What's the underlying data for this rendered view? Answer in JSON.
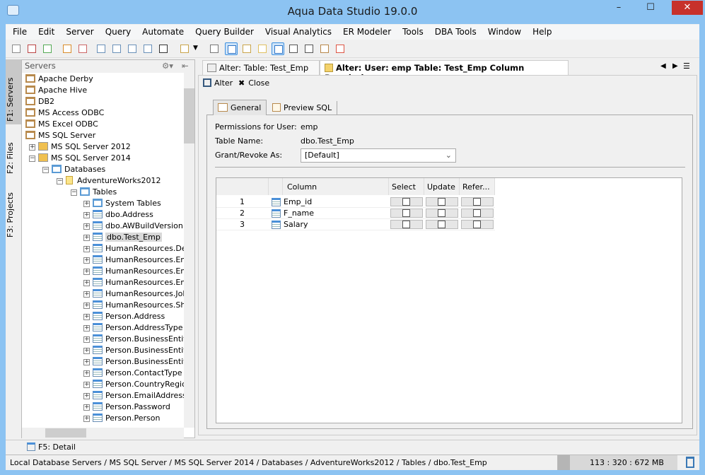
{
  "window": {
    "title": "Aqua Data Studio 19.0.0",
    "controls": [
      "–",
      "☐",
      "✕"
    ]
  },
  "menu": [
    "File",
    "Edit",
    "Server",
    "Query",
    "Automate",
    "Query Builder",
    "Visual Analytics",
    "ER Modeler",
    "Tools",
    "DBA Tools",
    "Window",
    "Help"
  ],
  "side_tabs": [
    "F1: Servers",
    "F2: Files",
    "F3: Projects"
  ],
  "servers": {
    "title": "Servers",
    "tree": [
      {
        "label": "Apache Derby",
        "level": 0,
        "icon": "folder-icon"
      },
      {
        "label": "Apache Hive",
        "level": 0,
        "icon": "folder-icon"
      },
      {
        "label": "DB2",
        "level": 0,
        "icon": "folder-icon"
      },
      {
        "label": "MS Access ODBC",
        "level": 0,
        "icon": "folder-icon"
      },
      {
        "label": "MS Excel ODBC",
        "level": 0,
        "icon": "folder-icon"
      },
      {
        "label": "MS SQL Server",
        "level": 0,
        "icon": "folder-icon"
      },
      {
        "label": "MS SQL Server 2012",
        "level": 1,
        "icon": "server-icon",
        "exp": "+"
      },
      {
        "label": "MS SQL Server 2014",
        "level": 1,
        "icon": "server-connected-icon",
        "exp": "−"
      },
      {
        "label": "Databases",
        "level": 2,
        "icon": "databases-icon",
        "exp": "−"
      },
      {
        "label": "AdventureWorks2012",
        "level": 3,
        "icon": "database-icon",
        "exp": "−"
      },
      {
        "label": "Tables",
        "level": 4,
        "icon": "tables-folder-icon",
        "exp": "−"
      },
      {
        "label": "System Tables",
        "level": 5,
        "icon": "tables-folder-icon",
        "exp": "+"
      },
      {
        "label": "dbo.Address",
        "level": 5,
        "icon": "table-icon",
        "exp": "+"
      },
      {
        "label": "dbo.AWBuildVersion",
        "level": 5,
        "icon": "table-icon",
        "exp": "+"
      },
      {
        "label": "dbo.Test_Emp",
        "level": 5,
        "icon": "table-icon",
        "exp": "+",
        "selected": true
      },
      {
        "label": "HumanResources.Depa",
        "level": 5,
        "icon": "table-icon",
        "exp": "+"
      },
      {
        "label": "HumanResources.Emplo",
        "level": 5,
        "icon": "table-icon",
        "exp": "+"
      },
      {
        "label": "HumanResources.Emplo",
        "level": 5,
        "icon": "table-icon",
        "exp": "+"
      },
      {
        "label": "HumanResources.Emplo",
        "level": 5,
        "icon": "table-icon",
        "exp": "+"
      },
      {
        "label": "HumanResources.JobC",
        "level": 5,
        "icon": "table-icon",
        "exp": "+"
      },
      {
        "label": "HumanResources.Shift",
        "level": 5,
        "icon": "table-icon",
        "exp": "+"
      },
      {
        "label": "Person.Address",
        "level": 5,
        "icon": "table-icon",
        "exp": "+"
      },
      {
        "label": "Person.AddressType",
        "level": 5,
        "icon": "table-icon",
        "exp": "+"
      },
      {
        "label": "Person.BusinessEntity",
        "level": 5,
        "icon": "table-icon",
        "exp": "+"
      },
      {
        "label": "Person.BusinessEntityA",
        "level": 5,
        "icon": "table-icon",
        "exp": "+"
      },
      {
        "label": "Person.BusinessEntityC",
        "level": 5,
        "icon": "table-icon",
        "exp": "+"
      },
      {
        "label": "Person.ContactType",
        "level": 5,
        "icon": "table-icon",
        "exp": "+"
      },
      {
        "label": "Person.CountryRegion",
        "level": 5,
        "icon": "table-icon",
        "exp": "+"
      },
      {
        "label": "Person.EmailAddress",
        "level": 5,
        "icon": "table-icon",
        "exp": "+"
      },
      {
        "label": "Person.Password",
        "level": 5,
        "icon": "table-icon",
        "exp": "+"
      },
      {
        "label": "Person.Person",
        "level": 5,
        "icon": "table-icon",
        "exp": "+"
      }
    ]
  },
  "editor_tabs": [
    {
      "label": "Alter: Table: Test_Emp",
      "active": false
    },
    {
      "label": "Alter: User: emp Table: Test_Emp Column Permissions",
      "active": true
    }
  ],
  "editor": {
    "actions": {
      "alter": "Alter",
      "close": "Close"
    },
    "inner_tabs": [
      "General",
      "Preview SQL"
    ],
    "fields": {
      "user_label": "Permissions for User:",
      "user_value": "emp",
      "table_label": "Table Name:",
      "table_value": "dbo.Test_Emp",
      "grant_label": "Grant/Revoke As:",
      "grant_value": "[Default]"
    },
    "grid": {
      "headers": [
        "Column",
        "Select",
        "Update",
        "Refer..."
      ],
      "rows": [
        {
          "n": "1",
          "column": "Emp_id",
          "select": false,
          "update": false,
          "refer": false
        },
        {
          "n": "2",
          "column": "F_name",
          "select": false,
          "update": false,
          "refer": false
        },
        {
          "n": "3",
          "column": "Salary",
          "select": false,
          "update": false,
          "refer": false
        }
      ]
    }
  },
  "detail_tab": "F5: Detail",
  "status": {
    "path": "Local Database Servers / MS SQL Server / MS SQL Server 2014 / Databases / AdventureWorks2012 / Tables / dbo.Test_Emp",
    "memory": "113 : 320 : 672 MB"
  }
}
